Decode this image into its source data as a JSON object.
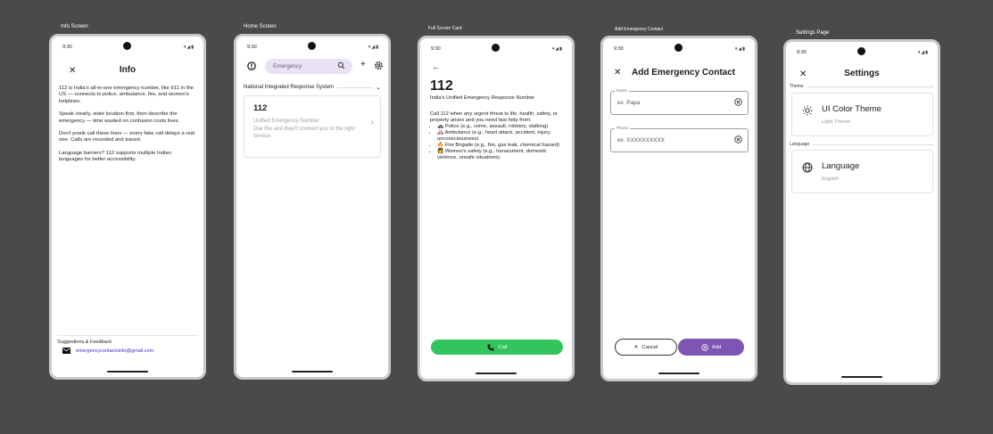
{
  "labels": {
    "info": "Info Screen",
    "home": "Home Screen",
    "full": "Full Screen Card",
    "add": "Add Emergency Contact",
    "settings": "Settings Page"
  },
  "status": {
    "time": "9:30"
  },
  "info": {
    "title": "Info",
    "paragraphs": [
      "112 is India's all-in-one emergency number, like 911 in the US — connects to police, ambulance, fire, and women's helplines.",
      "Speak clearly, state location first, then describe the emergency — time wasted on confusion costs lives.",
      "Don't prank call these lines — every fake call delays a real one. Calls are recorded and traced.",
      "Language barriers? 112 supports multiple Indian languages for better accessibility."
    ],
    "footer_title": "Suggestions & Feedback",
    "email": "emergencycontactsinfo@gmail.com"
  },
  "home": {
    "search_placeholder": "Emergency",
    "dropdown": "National Integrated Response System",
    "card_number": "112",
    "card_title": "Unified Emergency Number",
    "card_desc": "Dial this and they'll connect you to the right service."
  },
  "full": {
    "number": "112",
    "subtitle": "India's Unified Emergency Response Number",
    "intro": "Call 112 when any urgent threat to life, health, safety, or property arises and you need fast help from:",
    "items": [
      "🚓 Police (e.g., crime, assault, robbery, stalking)",
      "🚑 Ambulance (e.g., heart attack, accident, injury, unconsciousness)",
      "🔥 Fire Brigade (e.g., fire, gas leak, chemical hazard)",
      "👩 Women's safety (e.g., harassment, domestic violence, unsafe situations)"
    ],
    "call_label": "Call"
  },
  "add": {
    "title": "Add Emergency Contact",
    "name_label": "Name",
    "name_value": "ex. Papa",
    "phone_label": "Phone",
    "phone_value": "ex. XXXXXXXXXX",
    "cancel": "Cancel",
    "add": "Add"
  },
  "settings": {
    "title": "Settings",
    "theme_section": "Theme",
    "theme_title": "UI Color Theme",
    "theme_value": "Light Theme",
    "language_section": "Language",
    "language_title": "Language",
    "language_value": "English"
  },
  "colors": {
    "accent_purple": "#7c56b2",
    "call_green": "#32c55c",
    "background": "#4a4a4a"
  }
}
